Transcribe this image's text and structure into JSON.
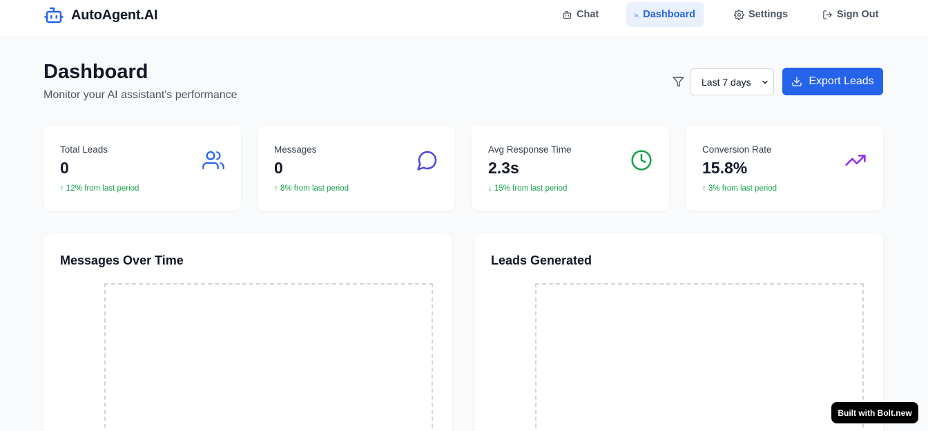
{
  "app": {
    "name": "AutoAgent.AI"
  },
  "nav": {
    "chat": "Chat",
    "dashboard": "Dashboard",
    "settings": "Settings",
    "signout": "Sign Out"
  },
  "header": {
    "title": "Dashboard",
    "subtitle": "Monitor your AI assistant's performance"
  },
  "controls": {
    "range_selected": "Last 7 days",
    "export_label": "Export Leads"
  },
  "stats": [
    {
      "label": "Total Leads",
      "value": "0",
      "change": "↑ 12% from last period",
      "icon": "users-icon",
      "icon_color": "#2563eb"
    },
    {
      "label": "Messages",
      "value": "0",
      "change": "↑ 8% from last period",
      "icon": "message-circle-icon",
      "icon_color": "#4f46e5"
    },
    {
      "label": "Avg Response Time",
      "value": "2.3s",
      "change": "↓ 15% from last period",
      "icon": "clock-icon",
      "icon_color": "#16a34a"
    },
    {
      "label": "Conversion Rate",
      "value": "15.8%",
      "change": "↑ 3% from last period",
      "icon": "trending-up-icon",
      "icon_color": "#9333ea"
    }
  ],
  "charts": {
    "messages_title": "Messages Over Time",
    "leads_title": "Leads Generated"
  },
  "badge": {
    "label": "Built with Bolt.new"
  },
  "colors": {
    "accent": "#2563eb",
    "positive": "#16a34a"
  }
}
